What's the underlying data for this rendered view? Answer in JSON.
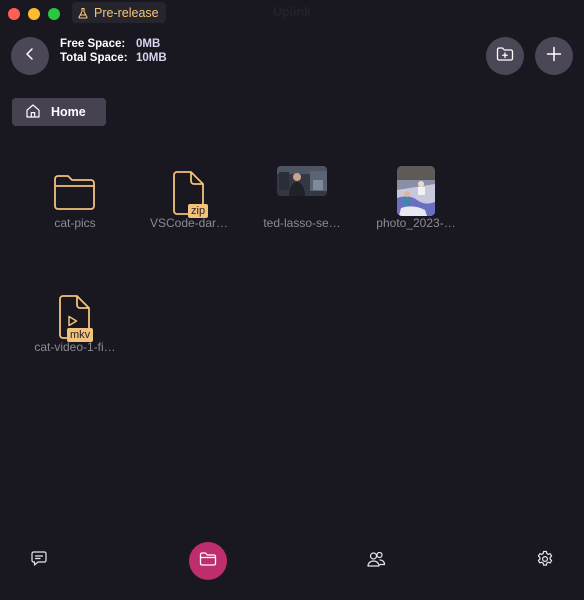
{
  "titlebar": {
    "title": "Uplink",
    "prerelease_label": "Pre-release"
  },
  "storage": {
    "free_label": "Free Space:",
    "free_value": "0MB",
    "total_label": "Total Space:",
    "total_value": "10MB"
  },
  "breadcrumb": {
    "home_label": "Home"
  },
  "files": [
    {
      "name": "cat-pics",
      "type": "folder"
    },
    {
      "name": "VSCode-dar…",
      "type": "file",
      "badge": "zip"
    },
    {
      "name": "ted-lasso-se…",
      "type": "image"
    },
    {
      "name": "photo_2023-…",
      "type": "image"
    },
    {
      "name": "cat-video-1-fi…",
      "type": "video",
      "badge": "mkv"
    }
  ],
  "colors": {
    "accent": "#be2e6f",
    "icon_gold": "#f2c17a",
    "background": "#19171f"
  }
}
